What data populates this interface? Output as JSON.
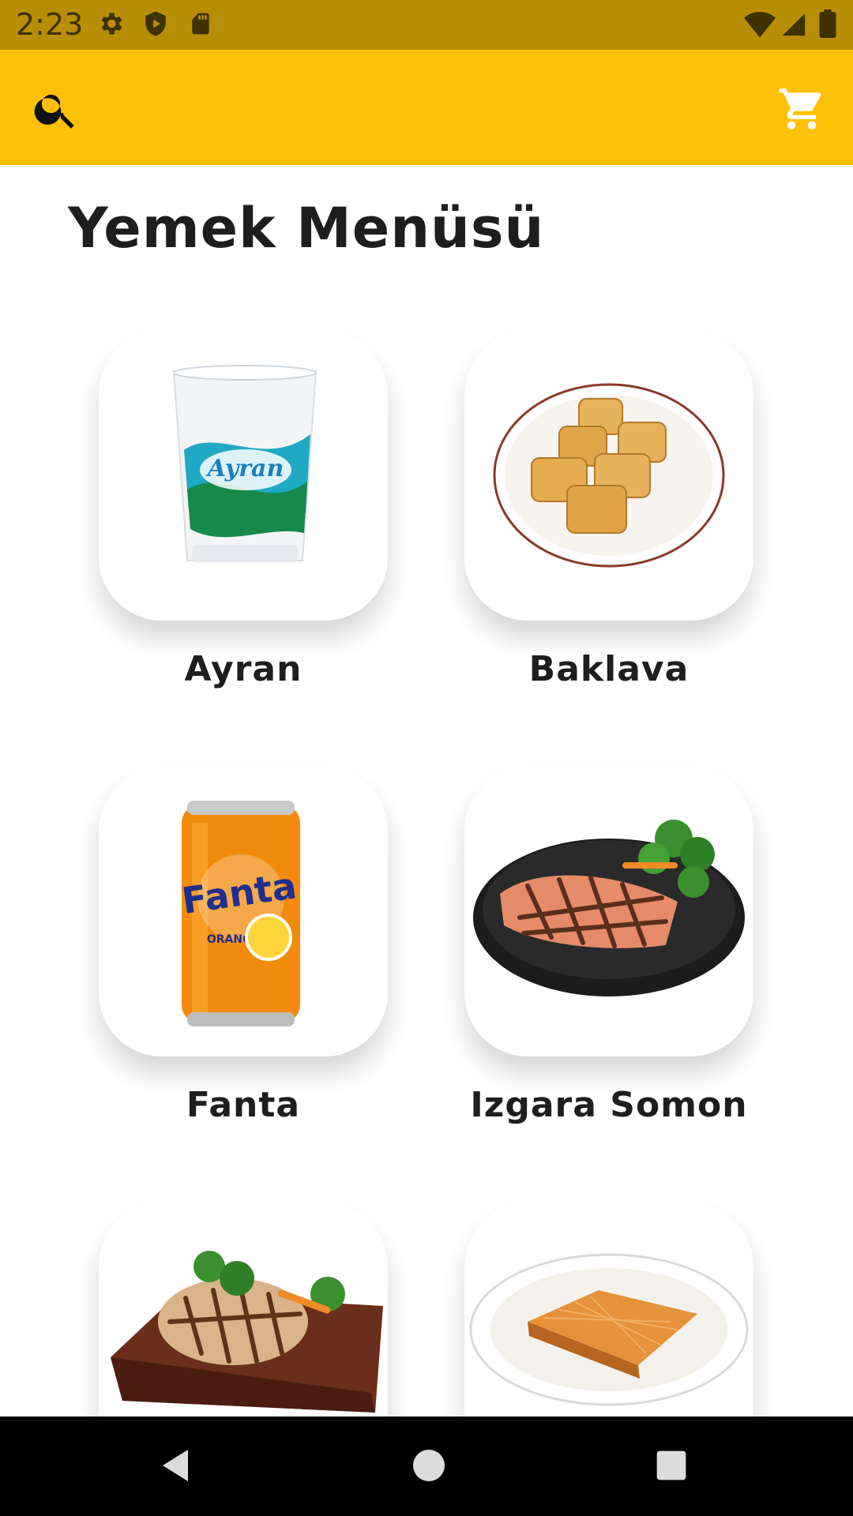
{
  "status_bar": {
    "time": "2:23",
    "icons": [
      "settings-icon",
      "shield-icon",
      "sd-card-icon",
      "wifi-icon",
      "signal-icon",
      "battery-icon"
    ]
  },
  "app_bar": {
    "color": "#FFC107",
    "left_icon": "search-icon",
    "right_icon": "shopping-cart-icon"
  },
  "page": {
    "title": "Yemek Menüsü"
  },
  "menu_items": [
    {
      "name": "Ayran",
      "image": "ayran-cup-image"
    },
    {
      "name": "Baklava",
      "image": "baklava-plate-image"
    },
    {
      "name": "Fanta",
      "image": "fanta-can-image"
    },
    {
      "name": "Izgara Somon",
      "image": "grilled-salmon-image"
    },
    {
      "name": "",
      "image": "grilled-chicken-image"
    },
    {
      "name": "",
      "image": "kunefe-plate-image"
    }
  ],
  "nav_bar": {
    "buttons": [
      "back-icon",
      "home-icon",
      "recents-icon"
    ]
  }
}
